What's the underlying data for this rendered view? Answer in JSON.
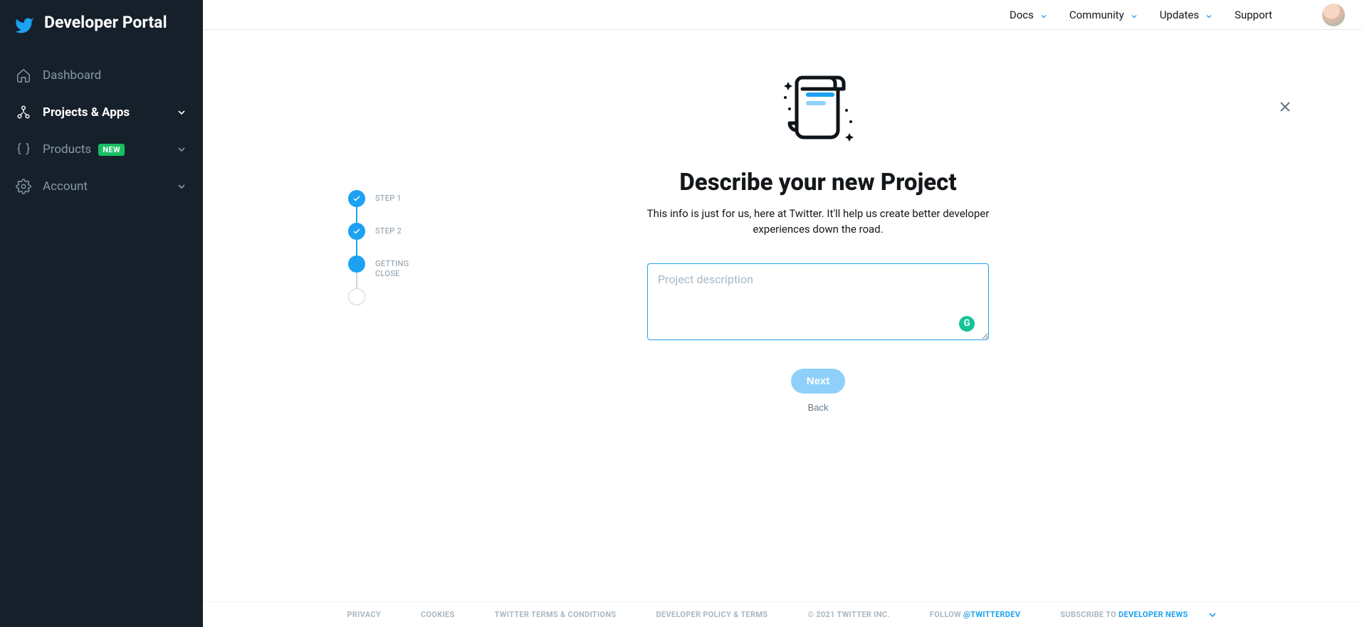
{
  "brand_title": "Developer Portal",
  "sidebar": {
    "items": [
      {
        "label": "Dashboard"
      },
      {
        "label": "Projects & Apps"
      },
      {
        "label": "Products"
      },
      {
        "label": "Account"
      }
    ],
    "new_badge": "NEW"
  },
  "topnav": {
    "docs": "Docs",
    "community": "Community",
    "updates": "Updates",
    "support": "Support"
  },
  "wizard": {
    "steps": [
      {
        "label": "STEP 1"
      },
      {
        "label": "STEP 2"
      },
      {
        "label": "GETTING CLOSE"
      },
      {
        "label": ""
      }
    ],
    "heading": "Describe your new Project",
    "subtext": "This info is just for us, here at Twitter. It'll help us create better developer experiences down the road.",
    "placeholder": "Project description",
    "value": "",
    "next_label": "Next",
    "back_label": "Back"
  },
  "footer": {
    "privacy": "PRIVACY",
    "cookies": "COOKIES",
    "terms": "TWITTER TERMS & CONDITIONS",
    "dev_policy": "DEVELOPER POLICY & TERMS",
    "copyright": "© 2021 TWITTER INC.",
    "follow_pre": "FOLLOW ",
    "follow_handle": "@TWITTERDEV",
    "subscribe_pre": "SUBSCRIBE TO ",
    "subscribe_link": "DEVELOPER NEWS"
  },
  "colors": {
    "accent": "#1da1f2",
    "sidebar_bg": "#15202b"
  }
}
